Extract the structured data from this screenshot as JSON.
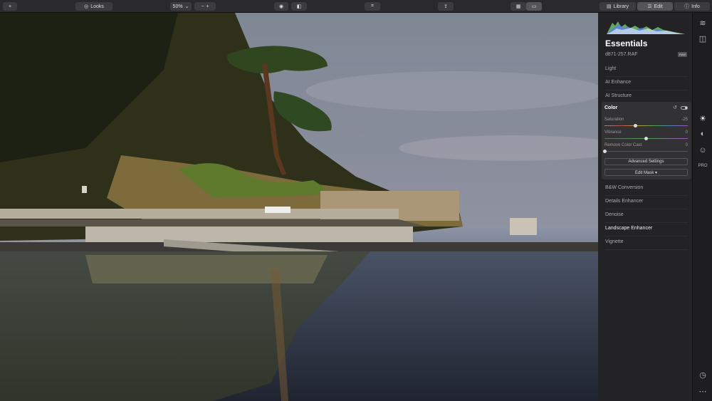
{
  "toolbar": {
    "looks_label": "Looks",
    "zoom_value": "50%",
    "tabs": {
      "library": "Library",
      "edit": "Edit",
      "info": "Info"
    }
  },
  "panel": {
    "title": "Essentials",
    "filename": "d871-257.RAF",
    "file_badge": "RAW",
    "sections_top": [
      "Light",
      "AI Enhance",
      "AI Structure"
    ],
    "color": {
      "title": "Color",
      "sliders": [
        {
          "label": "Saturation",
          "value": "-25",
          "level": -0.25
        },
        {
          "label": "Vibrance",
          "value": "0",
          "level": 0
        },
        {
          "label": "Remove Color Cast",
          "value": "0",
          "level": 0
        }
      ],
      "advanced_label": "Advanced Settings",
      "mask_label": "Edit Mask ▾"
    },
    "sections_bottom": [
      {
        "label": "B&W Conversion",
        "highlight": false
      },
      {
        "label": "Details Enhancer",
        "highlight": false
      },
      {
        "label": "Denoise",
        "highlight": false
      },
      {
        "label": "Landscape Enhancer",
        "highlight": true
      },
      {
        "label": "Vignette",
        "highlight": false
      }
    ]
  },
  "rail": {
    "pro_label": "PRO"
  },
  "colors": {
    "accent": "#ffffff",
    "panel_bg": "#232325"
  }
}
